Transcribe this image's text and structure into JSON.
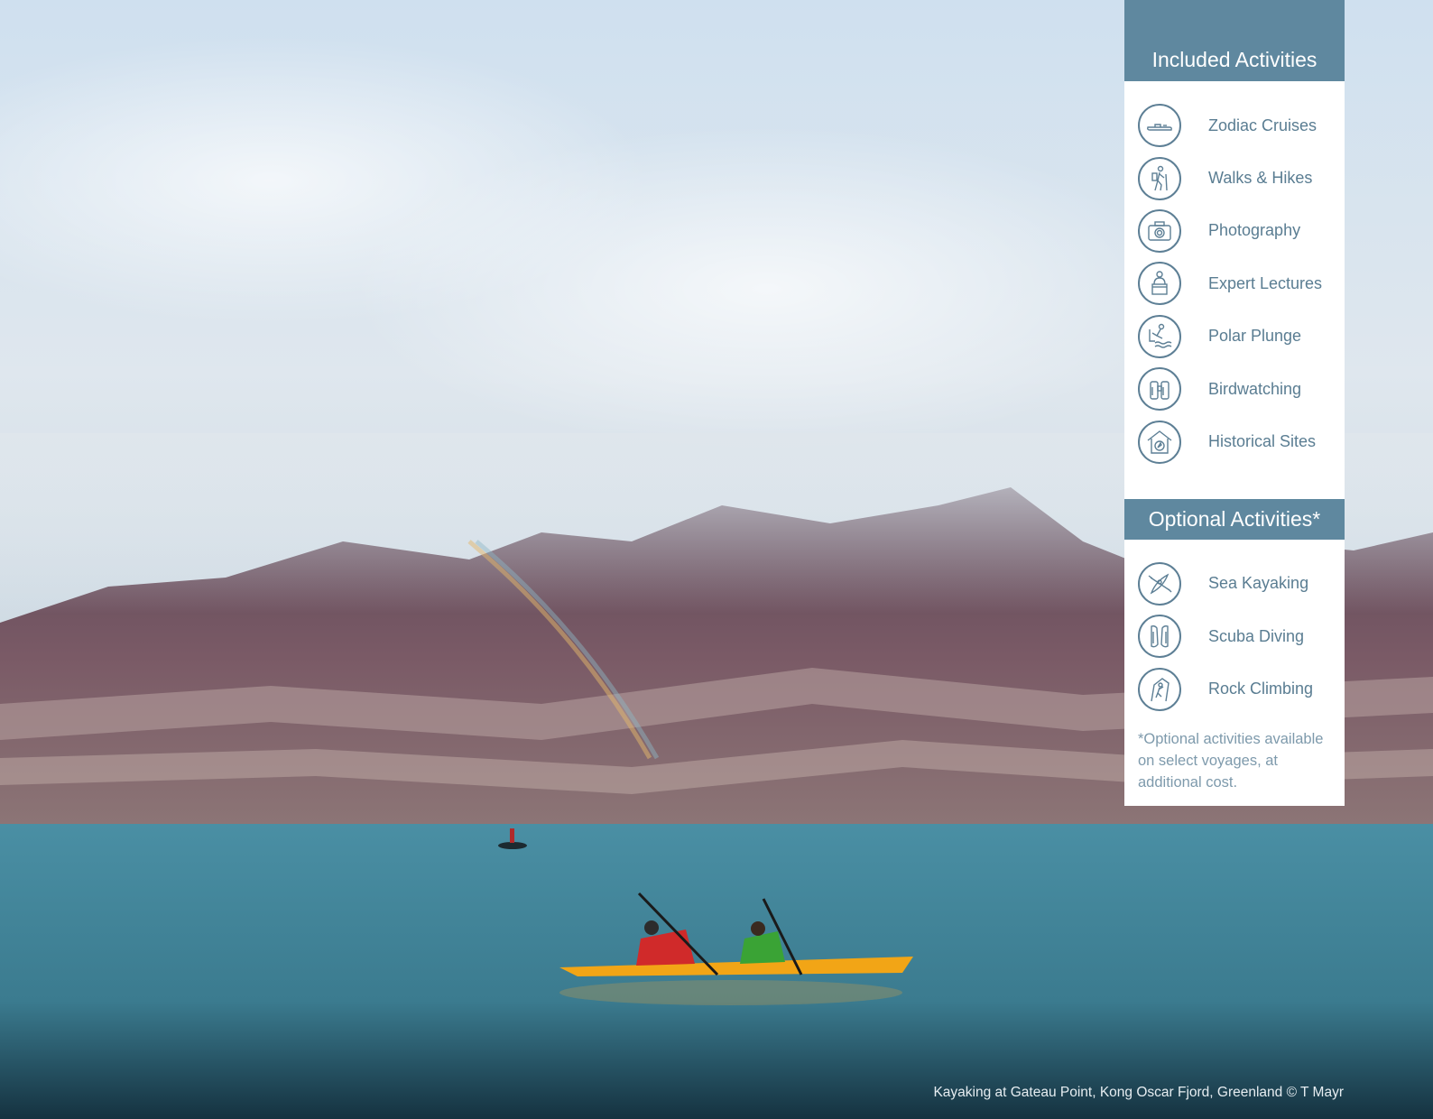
{
  "included": {
    "title": "Included Activities",
    "items": [
      {
        "label": "Zodiac Cruises",
        "icon": "zodiac-boat-icon"
      },
      {
        "label": "Walks & Hikes",
        "icon": "hiker-icon"
      },
      {
        "label": "Photography",
        "icon": "camera-icon"
      },
      {
        "label": "Expert Lectures",
        "icon": "lecturer-icon"
      },
      {
        "label": "Polar Plunge",
        "icon": "plunge-icon"
      },
      {
        "label": "Birdwatching",
        "icon": "binoculars-icon"
      },
      {
        "label": "Historical Sites",
        "icon": "compass-house-icon"
      }
    ]
  },
  "optional": {
    "title": "Optional Activities*",
    "items": [
      {
        "label": "Sea Kayaking",
        "icon": "kayak-icon"
      },
      {
        "label": "Scuba Diving",
        "icon": "flippers-icon"
      },
      {
        "label": "Rock Climbing",
        "icon": "climber-icon"
      }
    ],
    "note": "*Optional activities available on select voyages, at additional cost."
  },
  "caption": "Kayaking at Gateau Point, Kong Oscar Fjord, Greenland © T Mayr",
  "colors": {
    "panel_header": "#5f889f",
    "item_text": "#5a7d92",
    "icon_stroke": "#5d7f95",
    "water": "#3f8193",
    "kayak": "#f2a516"
  }
}
